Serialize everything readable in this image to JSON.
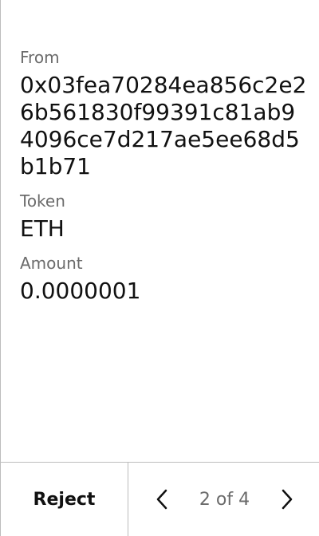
{
  "transaction": {
    "from_label": "From",
    "from_value": "0x03fea70284ea856c2e26b561830f99391c81ab94096ce7d217ae5ee68d5b1b71",
    "token_label": "Token",
    "token_value": "ETH",
    "amount_label": "Amount",
    "amount_value": "0.0000001"
  },
  "footer": {
    "reject_label": "Reject",
    "pager_text": "2 of 4",
    "prev_icon": "chevron-left-icon",
    "next_icon": "chevron-right-icon"
  },
  "colors": {
    "text": "#111111",
    "muted": "#6b6b6b",
    "divider": "#bdbdbd"
  }
}
